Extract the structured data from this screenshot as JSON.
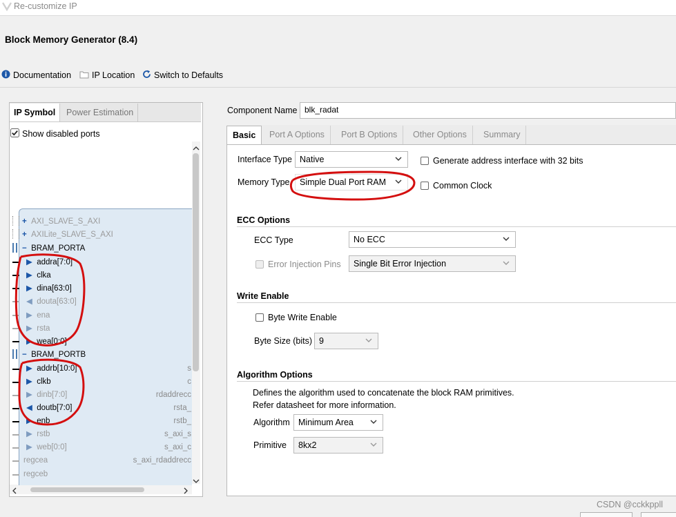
{
  "window": {
    "title": "Re-customize IP"
  },
  "product": {
    "title": "Block Memory Generator (8.4)"
  },
  "toolbar": {
    "documentation": "Documentation",
    "ip_location": "IP Location",
    "switch_defaults": "Switch to Defaults"
  },
  "left_panel": {
    "tabs": [
      "IP Symbol",
      "Power Estimation"
    ],
    "show_disabled_ports": "Show disabled ports",
    "show_disabled_checked": true,
    "interfaces": [
      "AXI_SLAVE_S_AXI",
      "AXILite_SLAVE_S_AXI",
      "BRAM_PORTA",
      "BRAM_PORTB"
    ],
    "porta_pins": [
      "addra[7:0]",
      "clka",
      "dina[63:0]",
      "douta[63:0]",
      "ena",
      "rsta",
      "wea[0:0]"
    ],
    "portb_pins": [
      "addrb[10:0]",
      "clkb",
      "dinb[7:0]",
      "doutb[7:0]",
      "enb",
      "rstb",
      "web[0:0]"
    ],
    "extra_pins": [
      "regcea",
      "regceb"
    ],
    "right_pins": [
      "s",
      "c",
      "rdaddrecc",
      "rsta_",
      "rstb_",
      "s_axi_s",
      "s_axi_c",
      "s_axi_rdaddrecc"
    ]
  },
  "right_panel": {
    "component_name_label": "Component Name",
    "component_name_value": "blk_radat",
    "tabs": [
      "Basic",
      "Port A Options",
      "Port B Options",
      "Other Options",
      "Summary"
    ],
    "interface_type_label": "Interface Type",
    "interface_type_value": "Native",
    "gen_addr_32": "Generate address interface with 32 bits",
    "memory_type_label": "Memory Type",
    "memory_type_value": "Simple Dual Port RAM",
    "common_clock": "Common Clock",
    "ecc_section": "ECC Options",
    "ecc_type_label": "ECC Type",
    "ecc_type_value": "No ECC",
    "error_injection_label": "Error Injection Pins",
    "error_injection_value": "Single Bit Error Injection",
    "write_enable_section": "Write Enable",
    "byte_write_enable": "Byte Write Enable",
    "byte_size_label": "Byte Size (bits)",
    "byte_size_value": "9",
    "algorithm_section": "Algorithm Options",
    "algorithm_desc_1": "Defines the algorithm used to concatenate the block RAM primitives.",
    "algorithm_desc_2": "Refer datasheet for more information.",
    "algorithm_label": "Algorithm",
    "algorithm_value": "Minimum Area",
    "primitive_label": "Primitive",
    "primitive_value": "8kx2"
  },
  "watermark": "CSDN @cckkppll",
  "colors": {
    "annotation_red": "#d40f0f",
    "info_blue": "#1c57a8",
    "symbol_fill": "#dfeaf4"
  }
}
